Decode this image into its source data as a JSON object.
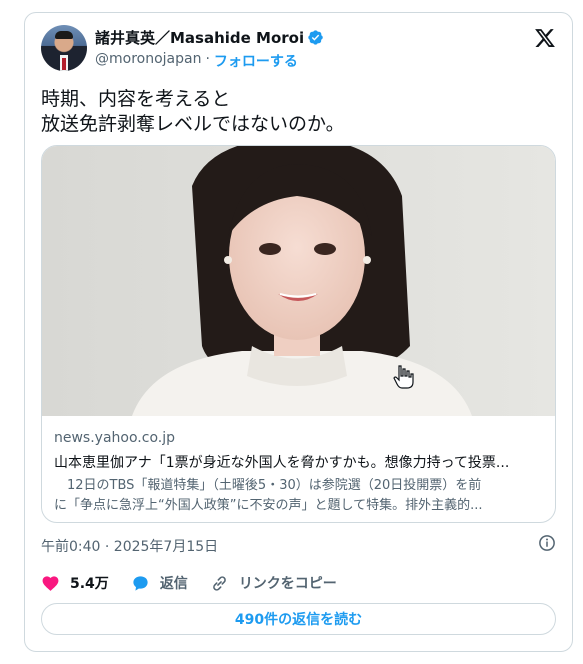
{
  "author": {
    "display_name": "諸井真英／Masahide Moroi",
    "handle": "@moronojapan",
    "separator": "·",
    "follow_label": "フォローする"
  },
  "tweet": {
    "lines": [
      "時期、内容を考えると",
      "放送免許剥奪レベルではないのか。"
    ]
  },
  "link_card": {
    "domain": "news.yahoo.co.jp",
    "title": "山本恵里伽アナ「1票が身近な外国人を脅かすかも。想像力持って投票...",
    "description_lines": [
      "　12日のTBS「報道特集」（土曜後5・30）は参院選（20日投開票）を前",
      "に「争点に急浮上“外国人政策”に不安の声」と題して特集。排外主義的..."
    ]
  },
  "timestamp": "午前0:40 · 2025年7月15日",
  "actions": {
    "likes": "5.4万",
    "reply_label": "返信",
    "copy_link_label": "リンクをコピー"
  },
  "read_replies_label": "490件の返信を読む",
  "icons": {
    "verified": "verified-badge-icon",
    "logo": "x-logo-icon",
    "info": "info-icon",
    "like": "heart-icon",
    "reply": "reply-bubble-icon",
    "link": "link-icon"
  },
  "colors": {
    "accent": "#1d9bf0",
    "like": "#f91880",
    "text": "#0f1419",
    "muted": "#536471",
    "border": "#cfd9de"
  }
}
